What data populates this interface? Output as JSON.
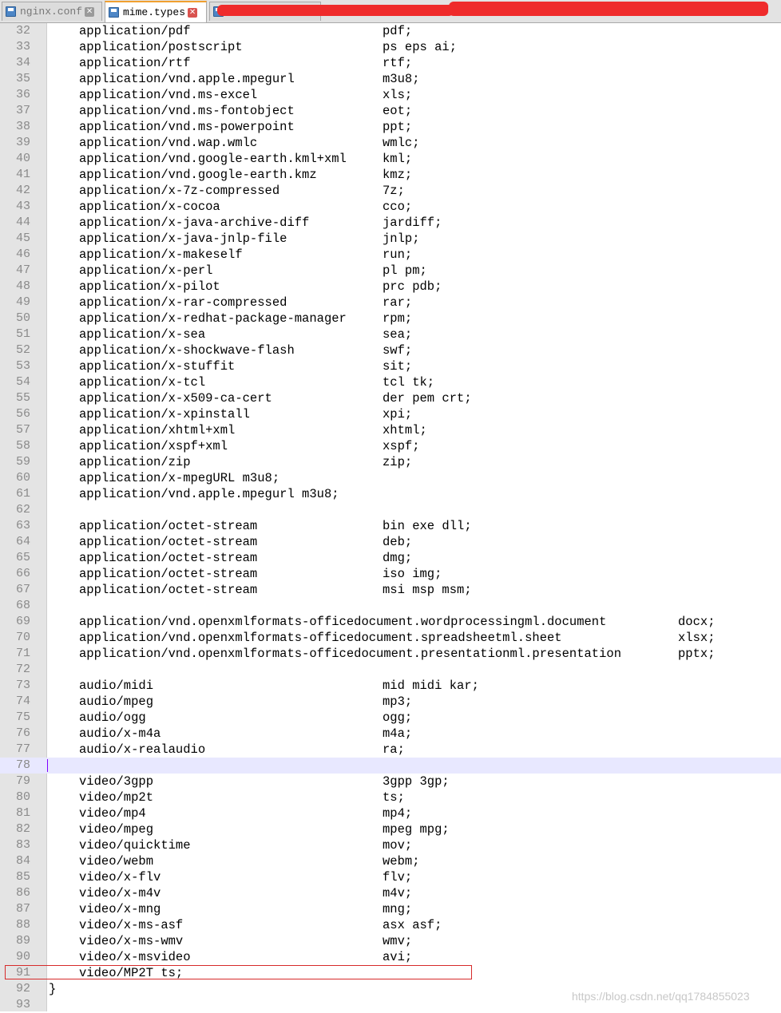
{
  "tabs": [
    {
      "label": "nginx.conf",
      "active": false
    },
    {
      "label": "mime.types",
      "active": true
    }
  ],
  "icons": {
    "save": "save-disk-icon",
    "close": "close-icon"
  },
  "lines": [
    {
      "n": "32",
      "t": "application/pdf",
      "e": "pdf;"
    },
    {
      "n": "33",
      "t": "application/postscript",
      "e": "ps eps ai;"
    },
    {
      "n": "34",
      "t": "application/rtf",
      "e": "rtf;"
    },
    {
      "n": "35",
      "t": "application/vnd.apple.mpegurl",
      "e": "m3u8;"
    },
    {
      "n": "36",
      "t": "application/vnd.ms-excel",
      "e": "xls;"
    },
    {
      "n": "37",
      "t": "application/vnd.ms-fontobject",
      "e": "eot;"
    },
    {
      "n": "38",
      "t": "application/vnd.ms-powerpoint",
      "e": "ppt;"
    },
    {
      "n": "39",
      "t": "application/vnd.wap.wmlc",
      "e": "wmlc;"
    },
    {
      "n": "40",
      "t": "application/vnd.google-earth.kml+xml",
      "e": "kml;"
    },
    {
      "n": "41",
      "t": "application/vnd.google-earth.kmz",
      "e": "kmz;"
    },
    {
      "n": "42",
      "t": "application/x-7z-compressed",
      "e": "7z;"
    },
    {
      "n": "43",
      "t": "application/x-cocoa",
      "e": "cco;"
    },
    {
      "n": "44",
      "t": "application/x-java-archive-diff",
      "e": "jardiff;"
    },
    {
      "n": "45",
      "t": "application/x-java-jnlp-file",
      "e": "jnlp;"
    },
    {
      "n": "46",
      "t": "application/x-makeself",
      "e": "run;"
    },
    {
      "n": "47",
      "t": "application/x-perl",
      "e": "pl pm;"
    },
    {
      "n": "48",
      "t": "application/x-pilot",
      "e": "prc pdb;"
    },
    {
      "n": "49",
      "t": "application/x-rar-compressed",
      "e": "rar;"
    },
    {
      "n": "50",
      "t": "application/x-redhat-package-manager",
      "e": "rpm;"
    },
    {
      "n": "51",
      "t": "application/x-sea",
      "e": "sea;"
    },
    {
      "n": "52",
      "t": "application/x-shockwave-flash",
      "e": "swf;"
    },
    {
      "n": "53",
      "t": "application/x-stuffit",
      "e": "sit;"
    },
    {
      "n": "54",
      "t": "application/x-tcl",
      "e": "tcl tk;"
    },
    {
      "n": "55",
      "t": "application/x-x509-ca-cert",
      "e": "der pem crt;"
    },
    {
      "n": "56",
      "t": "application/x-xpinstall",
      "e": "xpi;"
    },
    {
      "n": "57",
      "t": "application/xhtml+xml",
      "e": "xhtml;"
    },
    {
      "n": "58",
      "t": "application/xspf+xml",
      "e": "xspf;"
    },
    {
      "n": "59",
      "t": "application/zip",
      "e": "zip;"
    },
    {
      "n": "60",
      "t": "application/x-mpegURL m3u8;",
      "e": ""
    },
    {
      "n": "61",
      "t": "application/vnd.apple.mpegurl m3u8;",
      "e": ""
    },
    {
      "n": "62",
      "t": "",
      "e": ""
    },
    {
      "n": "63",
      "t": "application/octet-stream",
      "e": "bin exe dll;"
    },
    {
      "n": "64",
      "t": "application/octet-stream",
      "e": "deb;"
    },
    {
      "n": "65",
      "t": "application/octet-stream",
      "e": "dmg;"
    },
    {
      "n": "66",
      "t": "application/octet-stream",
      "e": "iso img;"
    },
    {
      "n": "67",
      "t": "application/octet-stream",
      "e": "msi msp msm;"
    },
    {
      "n": "68",
      "t": "",
      "e": ""
    },
    {
      "n": "69",
      "t": "application/vnd.openxmlformats-officedocument.wordprocessingml.document",
      "e": "docx;",
      "far": true
    },
    {
      "n": "70",
      "t": "application/vnd.openxmlformats-officedocument.spreadsheetml.sheet",
      "e": "xlsx;",
      "far": true
    },
    {
      "n": "71",
      "t": "application/vnd.openxmlformats-officedocument.presentationml.presentation",
      "e": "pptx;",
      "far": true
    },
    {
      "n": "72",
      "t": "",
      "e": ""
    },
    {
      "n": "73",
      "t": "audio/midi",
      "e": "mid midi kar;"
    },
    {
      "n": "74",
      "t": "audio/mpeg",
      "e": "mp3;"
    },
    {
      "n": "75",
      "t": "audio/ogg",
      "e": "ogg;"
    },
    {
      "n": "76",
      "t": "audio/x-m4a",
      "e": "m4a;"
    },
    {
      "n": "77",
      "t": "audio/x-realaudio",
      "e": "ra;"
    },
    {
      "n": "78",
      "t": "",
      "e": "",
      "current": true
    },
    {
      "n": "79",
      "t": "video/3gpp",
      "e": "3gpp 3gp;"
    },
    {
      "n": "80",
      "t": "video/mp2t",
      "e": "ts;"
    },
    {
      "n": "81",
      "t": "video/mp4",
      "e": "mp4;"
    },
    {
      "n": "82",
      "t": "video/mpeg",
      "e": "mpeg mpg;"
    },
    {
      "n": "83",
      "t": "video/quicktime",
      "e": "mov;"
    },
    {
      "n": "84",
      "t": "video/webm",
      "e": "webm;"
    },
    {
      "n": "85",
      "t": "video/x-flv",
      "e": "flv;"
    },
    {
      "n": "86",
      "t": "video/x-m4v",
      "e": "m4v;"
    },
    {
      "n": "87",
      "t": "video/x-mng",
      "e": "mng;"
    },
    {
      "n": "88",
      "t": "video/x-ms-asf",
      "e": "asx asf;"
    },
    {
      "n": "89",
      "t": "video/x-ms-wmv",
      "e": "wmv;"
    },
    {
      "n": "90",
      "t": "video/x-msvideo",
      "e": "avi;"
    },
    {
      "n": "91",
      "t": "video/MP2T ts;",
      "e": ""
    },
    {
      "n": "92",
      "t": "",
      "e": "",
      "brace": "}"
    },
    {
      "n": "93",
      "t": "",
      "e": ""
    }
  ],
  "watermark": "https://blog.csdn.net/qq1784855023"
}
